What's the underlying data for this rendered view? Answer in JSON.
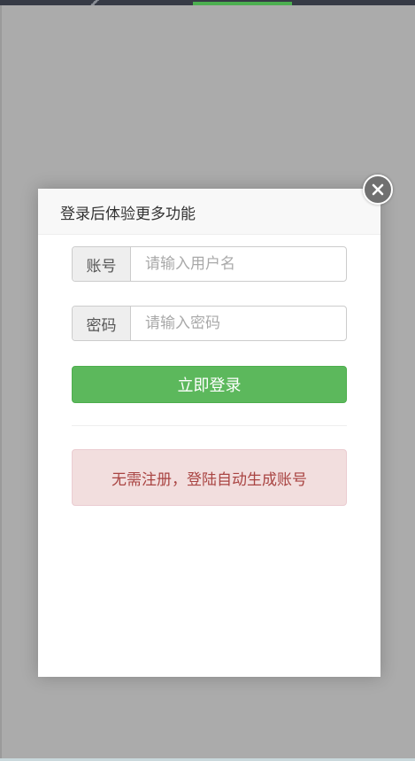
{
  "modal": {
    "title": "登录后体验更多功能",
    "account_label": "账号",
    "account_placeholder": "请输入用户名",
    "account_value": "",
    "password_label": "密码",
    "password_placeholder": "请输入密码",
    "password_value": "",
    "login_button": "立即登录",
    "notice": "无需注册，登陆自动生成账号",
    "close_icon": "close-icon"
  },
  "colors": {
    "overlay": "#ababab",
    "primary_green": "#5cb85c",
    "notice_bg": "#f2dede",
    "notice_text": "#a94442",
    "close_bg": "#707070"
  }
}
